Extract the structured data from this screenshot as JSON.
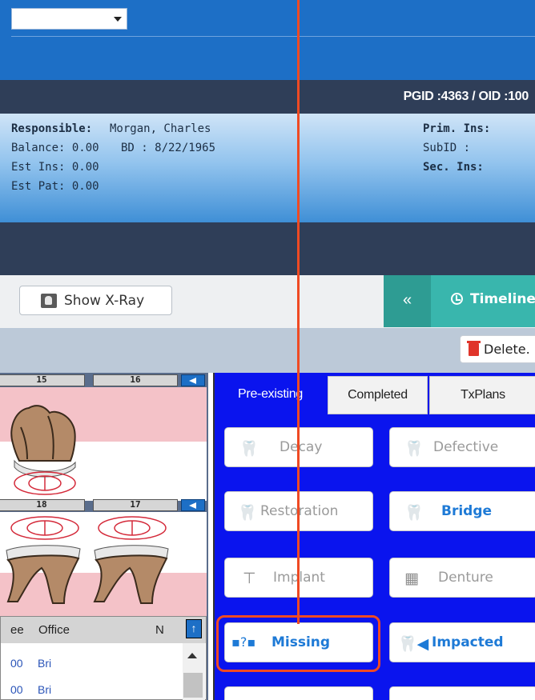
{
  "window": {
    "pgid_label": "PGID :4363 / OID :100"
  },
  "patient": {
    "responsible_label": "Responsible:",
    "responsible_value": "Morgan, Charles",
    "balance": "Balance: 0.00",
    "bd": "BD : 8/22/1965",
    "est_ins": "Est Ins: 0.00",
    "est_pat": "Est Pat: 0.00",
    "prim_ins_label": "Prim. Ins:",
    "subid_label": "SubID :",
    "sec_ins_label": "Sec. Ins:"
  },
  "toolbar": {
    "show_xray_label": "Show X-Ray",
    "collapse_label": "«",
    "timeline_label": "Timeline",
    "delete_label": "Delete."
  },
  "teeth": {
    "upper": [
      "15",
      "16"
    ],
    "lower": [
      "18",
      "17"
    ]
  },
  "grid": {
    "columns": [
      "ee",
      "Office",
      "N"
    ],
    "rows": [
      {
        "fee": "00",
        "office": "Bri"
      },
      {
        "fee": "00",
        "office": "Bri"
      }
    ],
    "up_label": "↑"
  },
  "tabs": [
    {
      "label": "Pre-existing",
      "active": true
    },
    {
      "label": "Completed",
      "active": false
    },
    {
      "label": "TxPlans",
      "active": false
    }
  ],
  "procedures": [
    {
      "label": "Decay",
      "icon": "tooth-icon",
      "style": "muted"
    },
    {
      "label": "Defective",
      "icon": "tooth-icon",
      "style": "muted"
    },
    {
      "label": "Restoration",
      "icon": "tooth-restoration-icon",
      "style": "muted"
    },
    {
      "label": "Bridge",
      "icon": "bridge-icon",
      "style": "strong"
    },
    {
      "label": "Implant",
      "icon": "implant-icon",
      "style": "muted"
    },
    {
      "label": "Denture",
      "icon": "denture-icon",
      "style": "muted"
    },
    {
      "label": "Missing",
      "icon": "missing-tooth-icon",
      "style": "strong"
    },
    {
      "label": "Impacted",
      "icon": "impacted-tooth-icon",
      "style": "strong"
    }
  ],
  "colors": {
    "accent_blue": "#1d6fc6",
    "dark_bar": "#2f3e58",
    "teal": "#39b6ad",
    "panel_blue": "#0a14ee",
    "highlight": "#ef4a23"
  }
}
